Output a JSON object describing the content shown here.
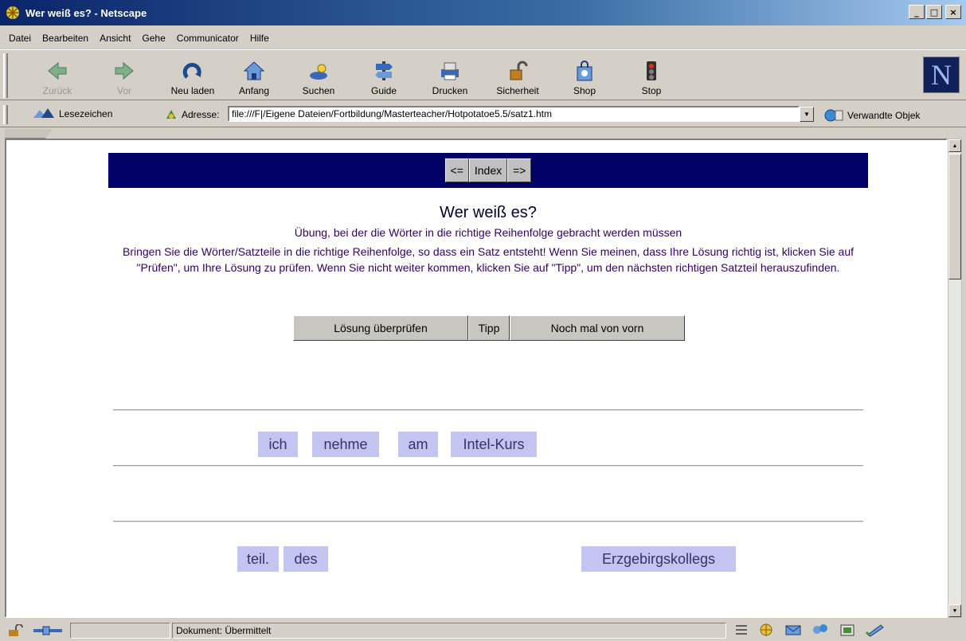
{
  "window": {
    "title": "Wer weiß es? - Netscape",
    "controls": [
      "_",
      "□",
      "×"
    ]
  },
  "menu": [
    "Datei",
    "Bearbeiten",
    "Ansicht",
    "Gehe",
    "Communicator",
    "Hilfe"
  ],
  "toolbar": {
    "buttons": [
      {
        "label": "Zurück",
        "icon": "back-arrow-icon",
        "enabled": false
      },
      {
        "label": "Vor",
        "icon": "forward-arrow-icon",
        "enabled": false
      },
      {
        "label": "Neu laden",
        "icon": "reload-icon",
        "enabled": true
      },
      {
        "label": "Anfang",
        "icon": "home-icon",
        "enabled": true
      },
      {
        "label": "Suchen",
        "icon": "search-icon",
        "enabled": true
      },
      {
        "label": "Guide",
        "icon": "guide-icon",
        "enabled": true
      },
      {
        "label": "Drucken",
        "icon": "print-icon",
        "enabled": true
      },
      {
        "label": "Sicherheit",
        "icon": "lock-icon",
        "enabled": true
      },
      {
        "label": "Shop",
        "icon": "shop-icon",
        "enabled": true
      },
      {
        "label": "Stop",
        "icon": "stop-icon",
        "enabled": true
      }
    ],
    "logo": "N"
  },
  "location": {
    "bookmarks_label": "Lesezeichen",
    "address_label": "Adresse:",
    "url": "file:///F|/Eigene Dateien/Fortbildung/Masterteacher/Hotpotatoe5.5/satz1.htm",
    "related_label": "Verwandte Objek"
  },
  "page": {
    "nav": {
      "prev": "<=",
      "index": "Index",
      "next": "=>"
    },
    "title": "Wer weiß es?",
    "subtitle": "Übung, bei der die Wörter in die richtige Reihenfolge gebracht werden müssen",
    "instructions": "Bringen Sie die Wörter/Satzteile in die richtige Reihenfolge, so dass ein Satz entsteht! Wenn Sie meinen, dass Ihre Lösung richtig ist, klicken Sie auf \"Prüfen\", um Ihre Lösung zu prüfen. Wenn Sie nicht weiter kommen, klicken Sie auf \"Tipp\", um den nächsten richtigen Satzteil herauszufinden.",
    "buttons": {
      "check": "Lösung überprüfen",
      "hint": "Tipp",
      "restart": "Noch mal von vorn"
    },
    "answer_words": [
      "ich",
      "nehme",
      "am",
      "Intel-Kurs"
    ],
    "pool_words": [
      "teil.",
      "des",
      "Erzgebirgskollegs"
    ],
    "colors": {
      "nav_bg": "#000066",
      "word_bg": "#c4c4f0",
      "text": "#330066"
    }
  },
  "status": {
    "text": "Dokument: Übermittelt"
  }
}
